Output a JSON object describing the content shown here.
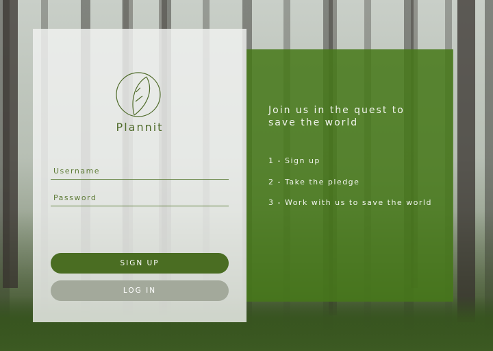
{
  "login": {
    "brand": "Plannit",
    "username_placeholder": "Username",
    "password_placeholder": "Password",
    "signup_label": "SIGN UP",
    "login_label": "LOG IN"
  },
  "info": {
    "tagline": "Join us in the quest to save the world",
    "steps": [
      "1 - Sign up",
      "2 - Take the pledge",
      "3 - Work with us to save the world"
    ]
  },
  "colors": {
    "brand_green": "#4a6d22",
    "info_panel": "#46781a",
    "login_button": "#a3a99b"
  }
}
